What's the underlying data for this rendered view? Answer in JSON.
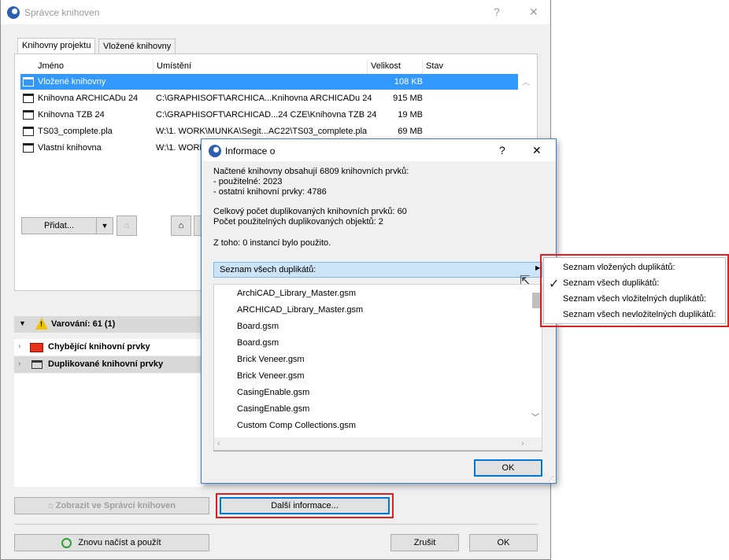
{
  "main_window": {
    "title": "Správce knihoven",
    "help_glyph": "?",
    "close_glyph": "✕",
    "tabs": [
      "Knihovny projektu",
      "Vložené knihovny"
    ],
    "columns": {
      "name": "Jméno",
      "location": "Umístění",
      "size": "Velikost",
      "status": "Stav"
    },
    "rows": [
      {
        "name": "Vložené knihovny",
        "location": "",
        "size": "108 KB",
        "selected": true
      },
      {
        "name": "Knihovna ARCHICADu 24",
        "location": "C:\\GRAPHISOFT\\ARCHICA...Knihovna ARCHICADu 24",
        "size": "915 MB"
      },
      {
        "name": "Knihovna TZB 24",
        "location": "C:\\GRAPHISOFT\\ARCHICAD...24 CZE\\Knihovna TZB 24",
        "size": "19 MB"
      },
      {
        "name": "TS03_complete.pla",
        "location": "W:\\1. WORK\\MUNKA\\Segit...AC22\\TS03_complete.pla",
        "size": "69 MB"
      },
      {
        "name": "Vlastní knihovna",
        "location": "W:\\1. WORK",
        "size": ""
      }
    ],
    "add_button": "Přidat...",
    "warnings_label": "Varování: 61 (1)",
    "warning_items": [
      {
        "label": "Chybějící knihovní prvky",
        "icon": "red-folder-icon"
      },
      {
        "label": "Duplikované knihovní prvky",
        "icon": "library-icon"
      }
    ],
    "show_in_manager": "Zobrazit ve Správci knihoven",
    "more_info": "Další informace...",
    "reload_apply": "Znovu načíst a použít",
    "cancel": "Zrušit",
    "ok": "OK"
  },
  "info_dialog": {
    "title": "Informace o",
    "help_glyph": "?",
    "close_glyph": "✕",
    "summary_lines": [
      "Načtené knihovny obsahují 6809 knihovních prvků:",
      "- použitelné: 2023",
      "- ostatní knihovní prvky: 4786"
    ],
    "dup_lines": [
      "Celkový počet duplikovaných knihovních prvků: 60",
      "Počet použitelných duplikovaných objektů: 2"
    ],
    "instances_line": "Z toho: 0 instancí bylo použito.",
    "dropdown_label": "Seznam všech duplikátů:",
    "duplicates": [
      "ArchiCAD_Library_Master.gsm",
      "ARCHICAD_Library_Master.gsm",
      "Board.gsm",
      "Board.gsm",
      "Brick Veneer.gsm",
      "Brick Veneer.gsm",
      "CasingEnable.gsm",
      "CasingEnable.gsm",
      "Custom Comp Collections.gsm"
    ],
    "ok": "OK"
  },
  "context_menu": {
    "items": [
      {
        "label": "Seznam vložených duplikátů:",
        "checked": false
      },
      {
        "label": "Seznam všech duplikátů:",
        "checked": true
      },
      {
        "label": "Seznam všech vložitelných duplikátů:",
        "checked": false
      },
      {
        "label": "Seznam všech nevložitelných duplikátů:",
        "checked": false
      }
    ]
  },
  "colors": {
    "selection": "#3399ff",
    "highlight_box": "#e02020",
    "dropdown_bg": "#cce4f7",
    "warning_bar": "#d9d9d9"
  }
}
